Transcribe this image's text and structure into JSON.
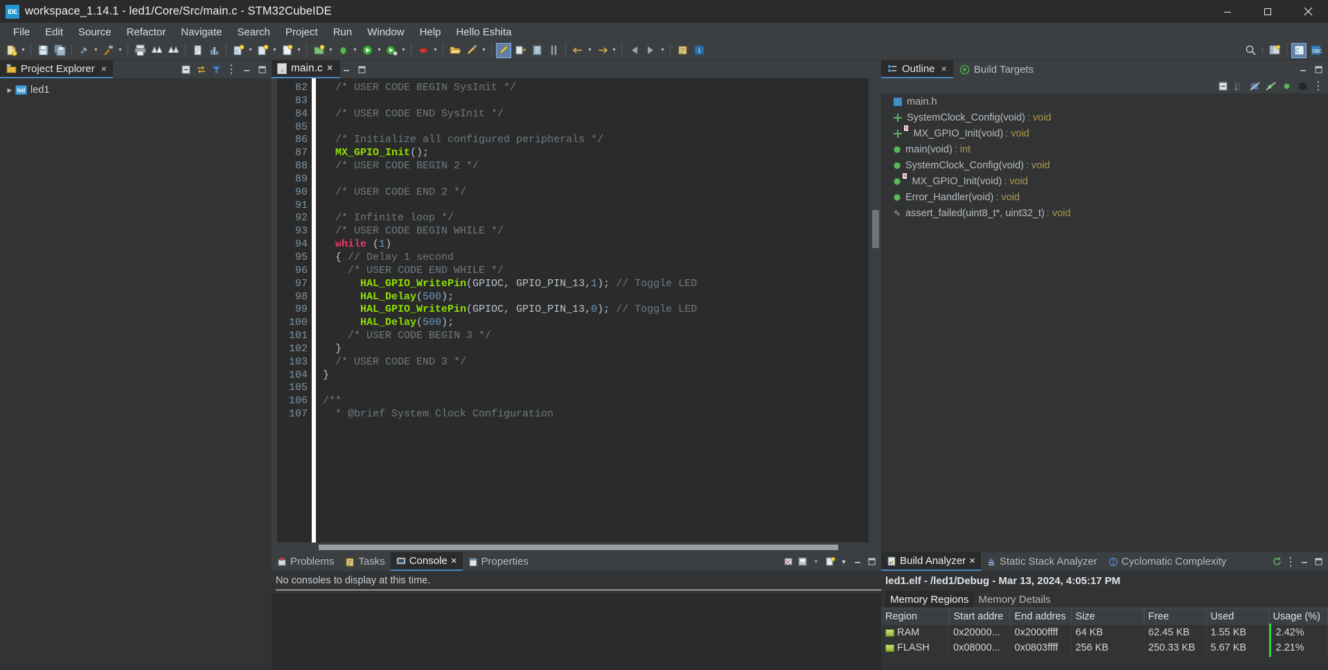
{
  "window": {
    "title": "workspace_1.14.1 - led1/Core/Src/main.c - STM32CubeIDE",
    "app_badge": "IDE",
    "minimize_label": "Minimize",
    "maximize_label": "Maximize",
    "close_label": "Close"
  },
  "menubar": {
    "items": [
      {
        "label": "File"
      },
      {
        "label": "Edit"
      },
      {
        "label": "Source"
      },
      {
        "label": "Refactor"
      },
      {
        "label": "Navigate"
      },
      {
        "label": "Search"
      },
      {
        "label": "Project"
      },
      {
        "label": "Run"
      },
      {
        "label": "Window"
      },
      {
        "label": "Help"
      },
      {
        "label": "Hello Eshita"
      }
    ]
  },
  "project_explorer": {
    "tab_label": "Project Explorer",
    "close_label": "×",
    "collapse_all_label": "Collapse All",
    "link_with_editor_label": "Link with Editor",
    "view_menu_label": "View Menu",
    "minimize_label": "Minimize",
    "maximize_label": "Maximize",
    "tree": [
      {
        "label": "led1",
        "twisty": "▶",
        "badge": "led"
      }
    ]
  },
  "editor": {
    "tab_label": "main.c",
    "tab_close": "×",
    "file_ext_badge": ".c",
    "minimize_label": "Minimize",
    "maximize_label": "Maximize",
    "first_line": 82,
    "lines": [
      {
        "n": 82,
        "tokens": [
          {
            "t": "  ",
            "c": "pl"
          },
          {
            "t": "/* USER CODE BEGIN SysInit */",
            "c": "cm"
          }
        ]
      },
      {
        "n": 83,
        "tokens": []
      },
      {
        "n": 84,
        "tokens": [
          {
            "t": "  ",
            "c": "pl"
          },
          {
            "t": "/* USER CODE END SysInit */",
            "c": "cm"
          }
        ]
      },
      {
        "n": 85,
        "tokens": []
      },
      {
        "n": 86,
        "tokens": [
          {
            "t": "  ",
            "c": "pl"
          },
          {
            "t": "/* Initialize all configured peripherals */",
            "c": "cm"
          }
        ]
      },
      {
        "n": 87,
        "tokens": [
          {
            "t": "  ",
            "c": "pl"
          },
          {
            "t": "MX_GPIO_Init",
            "c": "fn"
          },
          {
            "t": "();",
            "c": "pl"
          }
        ]
      },
      {
        "n": 88,
        "tokens": [
          {
            "t": "  ",
            "c": "pl"
          },
          {
            "t": "/* USER CODE BEGIN 2 */",
            "c": "cm"
          }
        ]
      },
      {
        "n": 89,
        "tokens": []
      },
      {
        "n": 90,
        "tokens": [
          {
            "t": "  ",
            "c": "pl"
          },
          {
            "t": "/* USER CODE END 2 */",
            "c": "cm"
          }
        ]
      },
      {
        "n": 91,
        "tokens": []
      },
      {
        "n": 92,
        "tokens": [
          {
            "t": "  ",
            "c": "pl"
          },
          {
            "t": "/* Infinite loop */",
            "c": "cm"
          }
        ]
      },
      {
        "n": 93,
        "tokens": [
          {
            "t": "  ",
            "c": "pl"
          },
          {
            "t": "/* USER CODE BEGIN WHILE */",
            "c": "cm"
          }
        ]
      },
      {
        "n": 94,
        "tokens": [
          {
            "t": "  ",
            "c": "pl"
          },
          {
            "t": "while",
            "c": "kw"
          },
          {
            "t": " (",
            "c": "pl"
          },
          {
            "t": "1",
            "c": "num"
          },
          {
            "t": ")",
            "c": "pl"
          }
        ]
      },
      {
        "n": 95,
        "tokens": [
          {
            "t": "  { ",
            "c": "pl"
          },
          {
            "t": "// Delay 1 second",
            "c": "cm"
          }
        ]
      },
      {
        "n": 96,
        "tokens": [
          {
            "t": "    ",
            "c": "pl"
          },
          {
            "t": "/* USER CODE END WHILE */",
            "c": "cm"
          }
        ]
      },
      {
        "n": 97,
        "tokens": [
          {
            "t": "      ",
            "c": "pl"
          },
          {
            "t": "HAL_GPIO_WritePin",
            "c": "fn"
          },
          {
            "t": "(GPIOC, GPIO_PIN_13,",
            "c": "pl"
          },
          {
            "t": "1",
            "c": "num"
          },
          {
            "t": "); ",
            "c": "pl"
          },
          {
            "t": "// Toggle LED",
            "c": "cm"
          }
        ]
      },
      {
        "n": 98,
        "tokens": [
          {
            "t": "      ",
            "c": "pl"
          },
          {
            "t": "HAL_Delay",
            "c": "fn"
          },
          {
            "t": "(",
            "c": "pl"
          },
          {
            "t": "500",
            "c": "num"
          },
          {
            "t": ");",
            "c": "pl"
          }
        ]
      },
      {
        "n": 99,
        "tokens": [
          {
            "t": "      ",
            "c": "pl"
          },
          {
            "t": "HAL_GPIO_WritePin",
            "c": "fn"
          },
          {
            "t": "(GPIOC, GPIO_PIN_13,",
            "c": "pl"
          },
          {
            "t": "0",
            "c": "num"
          },
          {
            "t": "); ",
            "c": "pl"
          },
          {
            "t": "// Toggle LED",
            "c": "cm"
          }
        ]
      },
      {
        "n": 100,
        "tokens": [
          {
            "t": "      ",
            "c": "pl"
          },
          {
            "t": "HAL_Delay",
            "c": "fn"
          },
          {
            "t": "(",
            "c": "pl"
          },
          {
            "t": "500",
            "c": "num"
          },
          {
            "t": ");",
            "c": "pl"
          }
        ]
      },
      {
        "n": 101,
        "tokens": [
          {
            "t": "    ",
            "c": "pl"
          },
          {
            "t": "/* USER CODE BEGIN 3 */",
            "c": "cm"
          }
        ]
      },
      {
        "n": 102,
        "tokens": [
          {
            "t": "  }",
            "c": "pl"
          }
        ]
      },
      {
        "n": 103,
        "tokens": [
          {
            "t": "  ",
            "c": "pl"
          },
          {
            "t": "/* USER CODE END 3 */",
            "c": "cm"
          }
        ]
      },
      {
        "n": 104,
        "tokens": [
          {
            "t": "}",
            "c": "pl"
          }
        ]
      },
      {
        "n": 105,
        "tokens": []
      },
      {
        "n": 106,
        "tokens": [
          {
            "t": "/**",
            "c": "cm"
          }
        ]
      },
      {
        "n": 107,
        "tokens": [
          {
            "t": "  * @brief System Clock Configuration",
            "c": "cm"
          }
        ]
      }
    ]
  },
  "console_panel": {
    "tabs": [
      {
        "label": "Problems",
        "active": false,
        "icon": "problems-icon"
      },
      {
        "label": "Tasks",
        "active": false,
        "icon": "tasks-icon"
      },
      {
        "label": "Console",
        "active": true,
        "icon": "console-icon"
      },
      {
        "label": "Properties",
        "active": false,
        "icon": "properties-icon"
      }
    ],
    "close_label": "×",
    "message": "No consoles to display at this time.",
    "actions": {
      "clear_label": "Clear Console",
      "pin_label": "Pin Console",
      "display_selected_label": "Display Selected Console",
      "open_console_label": "Open Console",
      "minimize_label": "Minimize",
      "maximize_label": "Maximize"
    }
  },
  "build_analyzer": {
    "tabs": [
      {
        "label": "Build Analyzer",
        "active": true,
        "icon": "build-analyzer-icon"
      },
      {
        "label": "Static Stack Analyzer",
        "active": false,
        "icon": "static-stack-icon"
      },
      {
        "label": "Cyclomatic Complexity",
        "active": false,
        "icon": "cyclomatic-icon"
      }
    ],
    "close_label": "×",
    "header": "led1.elf - /led1/Debug - Mar 13, 2024, 4:05:17 PM",
    "subtabs": [
      {
        "label": "Memory Regions",
        "active": true
      },
      {
        "label": "Memory Details",
        "active": false
      }
    ],
    "columns": [
      "Region",
      "Start addre",
      "End addres",
      "Size",
      "Free",
      "Used",
      "Usage (%)"
    ],
    "rows": [
      {
        "region": "RAM",
        "start": "0x20000...",
        "end": "0x2000ffff",
        "size": "64 KB",
        "free": "62.45 KB",
        "used": "1.55 KB",
        "usage": "2.42%"
      },
      {
        "region": "FLASH",
        "start": "0x08000...",
        "end": "0x0803ffff",
        "size": "256 KB",
        "free": "250.33 KB",
        "used": "5.67 KB",
        "usage": "2.21%"
      }
    ],
    "actions": {
      "refresh_label": "Refresh",
      "view_menu_label": "View Menu",
      "minimize_label": "Minimize",
      "maximize_label": "Maximize"
    }
  },
  "outline": {
    "tabs": [
      {
        "label": "Outline",
        "active": true,
        "icon": "outline-icon"
      },
      {
        "label": "Build Targets",
        "active": false,
        "icon": "build-targets-icon"
      }
    ],
    "close_label": "×",
    "minimize_label": "Minimize",
    "maximize_label": "Maximize",
    "toolbar": {
      "collapse_all_label": "Collapse All",
      "sort_label": "Sort",
      "hide_fields_label": "Hide Fields",
      "hide_static_label": "Hide Static Members",
      "hide_nonpublic_label": "Hide Non-Public Members",
      "hide_macros_label": "Hide Macros",
      "view_menu_label": "View Menu"
    },
    "items": [
      {
        "name": "main.h",
        "type": "",
        "icon": "header-icon",
        "static": false
      },
      {
        "name": "SystemClock_Config(void)",
        "type": " : void",
        "icon": "prototype-icon",
        "static": false
      },
      {
        "name": "MX_GPIO_Init(void)",
        "type": " : void",
        "icon": "prototype-icon",
        "static": true
      },
      {
        "name": "main(void)",
        "type": " : int",
        "icon": "function-icon",
        "static": false
      },
      {
        "name": "SystemClock_Config(void)",
        "type": " : void",
        "icon": "function-icon",
        "static": false
      },
      {
        "name": "MX_GPIO_Init(void)",
        "type": " : void",
        "icon": "function-icon",
        "static": true
      },
      {
        "name": "Error_Handler(void)",
        "type": " : void",
        "icon": "function-icon",
        "static": false
      },
      {
        "name": "assert_failed(uint8_t*, uint32_t)",
        "type": " : void",
        "icon": "macro-icon",
        "static": false
      }
    ]
  },
  "toolbar": {
    "search_label": "Search",
    "perspective_labels": [
      "Open Perspective",
      "C/C++",
      "Debug"
    ],
    "buttons": [
      "new-button",
      "save-button",
      "save-all-button",
      "print-button",
      "build-button",
      "build-all-button",
      "clean-button",
      "debug-button",
      "run-button",
      "external-tools-button",
      "new-c-project-button",
      "new-cpp-project-button",
      "search-button",
      "next-annotation-button",
      "previous-annotation-button",
      "back-button",
      "forward-button",
      "pin-editor-button",
      "info-button"
    ]
  },
  "colors": {
    "accent": "#4a88c7",
    "editor_bg": "#2b2b2b",
    "panel_bg": "#313335",
    "chrome_bg": "#3c3f41",
    "keyword": "#e8396a",
    "function": "#8ee000",
    "comment": "#6e7b82",
    "number": "#6897bb",
    "usage_bar": "#36d336"
  }
}
